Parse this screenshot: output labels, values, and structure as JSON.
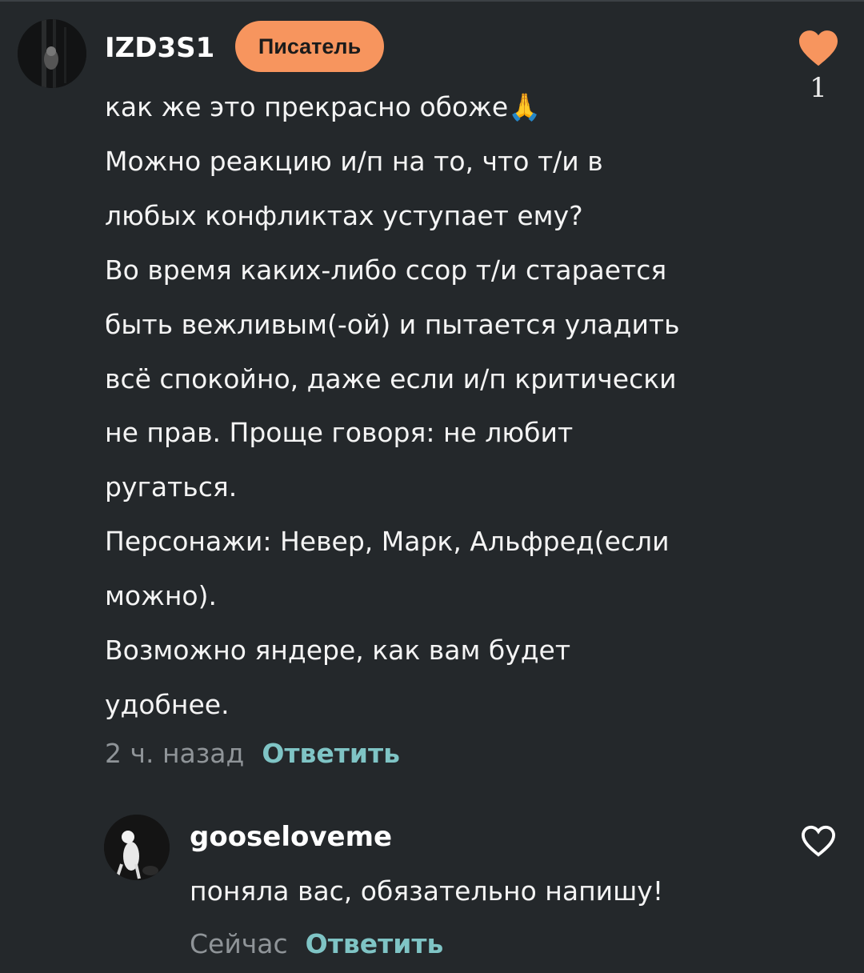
{
  "comments": [
    {
      "username": "IZD3S1",
      "badge": "Писатель",
      "lines": [
        "как же это прекрасно обоже🙏",
        "Можно реакцию и/п на то, что т/и в",
        "любых конфликтах уступает ему?",
        "Во время каких-либо ссор т/и старается",
        "быть вежливым(-ой) и пытается уладить",
        "всё спокойно, даже если и/п критически",
        "не прав. Проще говоря: не любит",
        "ругаться.",
        "Персонажи: Невер, Марк, Альфред(если",
        "можно).",
        "Возможно яндере, как вам будет",
        "удобнее."
      ],
      "time": "2 ч. назад",
      "reply_label": "Ответить",
      "like_count": "1",
      "liked": true
    }
  ],
  "replies": [
    {
      "username": "gooseloveme",
      "text": "поняла вас, обязательно напишу!",
      "time": "Сейчас",
      "reply_label": "Ответить",
      "liked": false
    }
  ],
  "colors": {
    "background": "#24282b",
    "badge": "#f7955e",
    "heart_filled": "#f7955e",
    "reply_link": "#7fc4c5",
    "time_text": "#8f9498"
  },
  "icons": {
    "like_filled": "heart-filled-icon",
    "like_outline": "heart-outline-icon"
  }
}
